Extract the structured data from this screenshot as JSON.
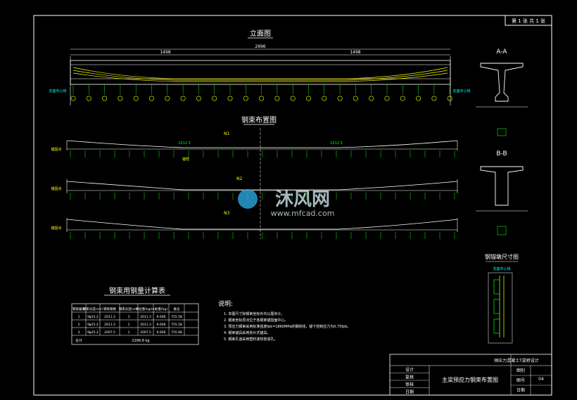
{
  "sheet": {
    "corner_label": "第 1 张 共 1 张"
  },
  "elevation": {
    "title": "立面图",
    "dim_total": "2996",
    "dim_half_left": "1498",
    "dim_half_right": "1498",
    "support_left": "支座中心线",
    "support_right": "支座中心线"
  },
  "tendon_layout": {
    "title": "钢束布置图",
    "labels": [
      "N1",
      "N2",
      "N3"
    ],
    "dim_a": "1012.5",
    "dim_b": "1012.5",
    "anchor_label": "锚固点",
    "path_label": "锚栓"
  },
  "section_aa": {
    "title": "A-A"
  },
  "section_bb": {
    "title": "B-B"
  },
  "anchor_detail": {
    "title": "钢锚墩尺寸图",
    "sub": "支座中心线"
  },
  "steel_table": {
    "title": "钢束用钢量计算表",
    "headers": [
      "钢束编号",
      "钢束长度(cm)",
      "钢束根数",
      "钢束长度(cm)",
      "单位重(kg/m)",
      "总重(kg)",
      "备注"
    ],
    "rows": [
      [
        "1",
        "9φ15.2",
        "2011.3",
        "1",
        "2011.3",
        "9.606",
        "755.58"
      ],
      [
        "2",
        "9φ15.2",
        "2011.3",
        "1",
        "2011.3",
        "9.606",
        "755.58"
      ],
      [
        "3",
        "9φ15.2",
        "2007.5",
        "1",
        "2007.5",
        "9.606",
        "755.68"
      ]
    ],
    "total_label": "合计",
    "total_value": "2296.8 kg"
  },
  "notes": {
    "title": "说明:",
    "items": [
      "1. 本图尺寸除钢束坐标外均以厘米计。",
      "2. 钢束坐标原点位于各钢束锚固面中心。",
      "3. 预应力钢束采用标准强度fpk=1860MPa的钢绞线，锚下控制应力为0.75fpk。",
      "4. 钢束锚具采用夹片式锚具。",
      "5. 钢束孔道采用塑料波纹管成孔。"
    ]
  },
  "title_block": {
    "project": "预应力混凝土T梁桥设计",
    "drawing_name": "主梁预应力钢束布置图",
    "rows": [
      "设计",
      "复核",
      "审核",
      "日期"
    ],
    "fields": [
      "图别",
      "图号",
      "日期"
    ],
    "drawing_no": "04"
  },
  "watermark": {
    "main": "沐风网",
    "url": "www.mfcad.com"
  },
  "colors": {
    "background": "#000000",
    "line": "#ffffff",
    "accent": "#ffff00",
    "green": "#00ff00",
    "cyan": "#00ffff"
  }
}
